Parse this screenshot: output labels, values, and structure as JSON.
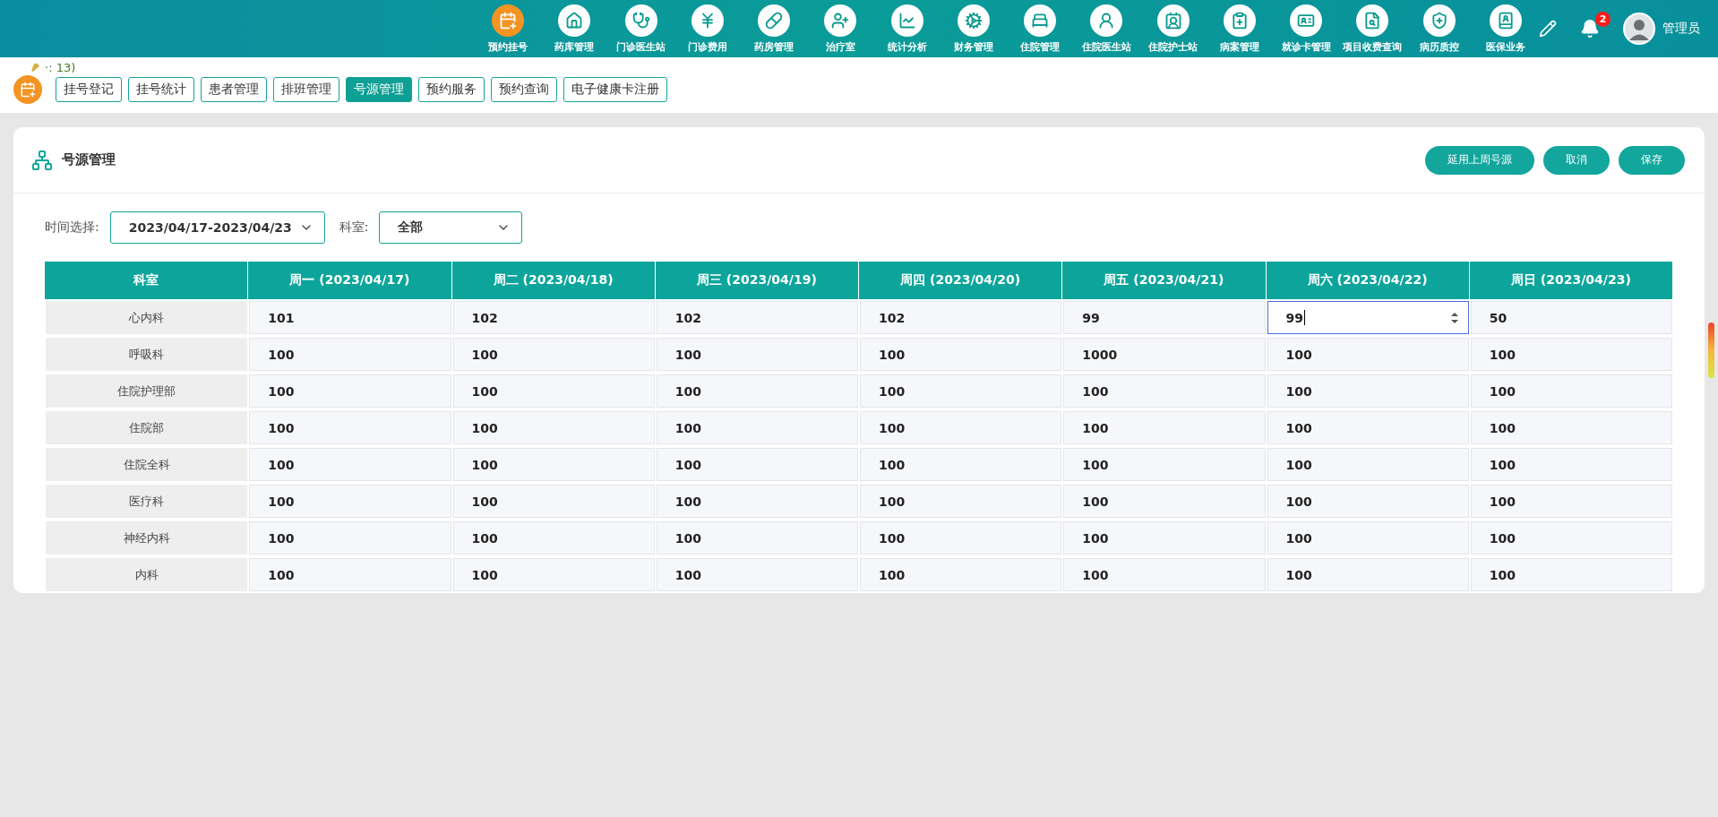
{
  "nav": {
    "items": [
      {
        "label": "预约挂号",
        "selected": true
      },
      {
        "label": "药库管理",
        "selected": false
      },
      {
        "label": "门诊医生站",
        "selected": false
      },
      {
        "label": "门诊费用",
        "selected": false
      },
      {
        "label": "药房管理",
        "selected": false
      },
      {
        "label": "治疗室",
        "selected": false
      },
      {
        "label": "统计分析",
        "selected": false
      },
      {
        "label": "财务管理",
        "selected": false
      },
      {
        "label": "住院管理",
        "selected": false
      },
      {
        "label": "住院医生站",
        "selected": false
      },
      {
        "label": "住院护士站",
        "selected": false
      },
      {
        "label": "病案管理",
        "selected": false
      },
      {
        "label": "就诊卡管理",
        "selected": false
      },
      {
        "label": "项目收费查询",
        "selected": false
      },
      {
        "label": "病历质控",
        "selected": false
      },
      {
        "label": "医保业务",
        "selected": false
      }
    ]
  },
  "header_tools": {
    "notification_count": "2",
    "user_name": "管理员"
  },
  "status_text": "·: 13)",
  "tabs": [
    {
      "label": "挂号登记",
      "selected": false
    },
    {
      "label": "挂号统计",
      "selected": false
    },
    {
      "label": "患者管理",
      "selected": false
    },
    {
      "label": "排班管理",
      "selected": false
    },
    {
      "label": "号源管理",
      "selected": true
    },
    {
      "label": "预约服务",
      "selected": false
    },
    {
      "label": "预约查询",
      "selected": false
    },
    {
      "label": "电子健康卡注册",
      "selected": false
    }
  ],
  "panel": {
    "title": "号源管理",
    "buttons": [
      "延用上周号源",
      "取消",
      "保存"
    ]
  },
  "filters": [
    {
      "label": "时间选择:",
      "value": "2023/04/17-2023/04/23"
    },
    {
      "label": "科室:",
      "value": "全部"
    }
  ],
  "table": {
    "columns": [
      "科室",
      "周一 (2023/04/17)",
      "周二 (2023/04/18)",
      "周三 (2023/04/19)",
      "周四 (2023/04/20)",
      "周五 (2023/04/21)",
      "周六 (2023/04/22)",
      "周日 (2023/04/23)"
    ],
    "rows": [
      {
        "department": "心内科",
        "cells": [
          {
            "value": "101",
            "focused": false
          },
          {
            "value": "102",
            "focused": false
          },
          {
            "value": "102",
            "focused": false
          },
          {
            "value": "102",
            "focused": false
          },
          {
            "value": "99",
            "focused": false
          },
          {
            "value": "99",
            "focused": true
          },
          {
            "value": "50",
            "focused": false
          }
        ]
      },
      {
        "department": "呼吸科",
        "cells": [
          {
            "value": "100",
            "focused": false
          },
          {
            "value": "100",
            "focused": false
          },
          {
            "value": "100",
            "focused": false
          },
          {
            "value": "100",
            "focused": false
          },
          {
            "value": "1000",
            "focused": false
          },
          {
            "value": "100",
            "focused": false
          },
          {
            "value": "100",
            "focused": false
          }
        ]
      },
      {
        "department": "住院护理部",
        "cells": [
          {
            "value": "100",
            "focused": false
          },
          {
            "value": "100",
            "focused": false
          },
          {
            "value": "100",
            "focused": false
          },
          {
            "value": "100",
            "focused": false
          },
          {
            "value": "100",
            "focused": false
          },
          {
            "value": "100",
            "focused": false
          },
          {
            "value": "100",
            "focused": false
          }
        ]
      },
      {
        "department": "住院部",
        "cells": [
          {
            "value": "100",
            "focused": false
          },
          {
            "value": "100",
            "focused": false
          },
          {
            "value": "100",
            "focused": false
          },
          {
            "value": "100",
            "focused": false
          },
          {
            "value": "100",
            "focused": false
          },
          {
            "value": "100",
            "focused": false
          },
          {
            "value": "100",
            "focused": false
          }
        ]
      },
      {
        "department": "住院全科",
        "cells": [
          {
            "value": "100",
            "focused": false
          },
          {
            "value": "100",
            "focused": false
          },
          {
            "value": "100",
            "focused": false
          },
          {
            "value": "100",
            "focused": false
          },
          {
            "value": "100",
            "focused": false
          },
          {
            "value": "100",
            "focused": false
          },
          {
            "value": "100",
            "focused": false
          }
        ]
      },
      {
        "department": "医疗科",
        "cells": [
          {
            "value": "100",
            "focused": false
          },
          {
            "value": "100",
            "focused": false
          },
          {
            "value": "100",
            "focused": false
          },
          {
            "value": "100",
            "focused": false
          },
          {
            "value": "100",
            "focused": false
          },
          {
            "value": "100",
            "focused": false
          },
          {
            "value": "100",
            "focused": false
          }
        ]
      },
      {
        "department": "神经内科",
        "cells": [
          {
            "value": "100",
            "focused": false
          },
          {
            "value": "100",
            "focused": false
          },
          {
            "value": "100",
            "focused": false
          },
          {
            "value": "100",
            "focused": false
          },
          {
            "value": "100",
            "focused": false
          },
          {
            "value": "100",
            "focused": false
          },
          {
            "value": "100",
            "focused": false
          }
        ]
      },
      {
        "department": "内科",
        "cells": [
          {
            "value": "100",
            "focused": false
          },
          {
            "value": "100",
            "focused": false
          },
          {
            "value": "100",
            "focused": false
          },
          {
            "value": "100",
            "focused": false
          },
          {
            "value": "100",
            "focused": false
          },
          {
            "value": "100",
            "focused": false
          },
          {
            "value": "100",
            "focused": false
          }
        ]
      }
    ]
  }
}
